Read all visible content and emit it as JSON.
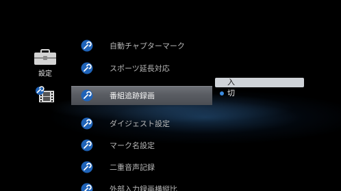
{
  "categories": [
    {
      "id": "settings",
      "label": "設定",
      "icon": "toolbox-icon"
    },
    {
      "id": "video",
      "label": "",
      "icon": "film-icon"
    }
  ],
  "settings_list": {
    "items": [
      {
        "label": "自動チャプターマーク",
        "icon": "wrench-icon",
        "selected": false
      },
      {
        "label": "スポーツ延長対応",
        "icon": "wrench-icon",
        "selected": false
      },
      {
        "label": "番組追跡録画",
        "icon": "wrench-icon",
        "selected": true
      },
      {
        "label": "ダイジェスト設定",
        "icon": "wrench-icon",
        "selected": false
      },
      {
        "label": "マーク名設定",
        "icon": "wrench-icon",
        "selected": false
      },
      {
        "label": "二重音声記録",
        "icon": "wrench-icon",
        "selected": false
      },
      {
        "label": "外部入力録画横縦比",
        "icon": "wrench-icon",
        "selected": false
      }
    ]
  },
  "options": {
    "items": [
      {
        "label": "入",
        "highlighted": true,
        "current": false
      },
      {
        "label": "切",
        "highlighted": false,
        "current": true
      }
    ]
  },
  "colors": {
    "background": "#000000",
    "selected_row": "#5a5d63",
    "option_highlight": "#cfd3d8",
    "current_dot": "#3b8be0",
    "wrench_icon": "#1f63b8"
  }
}
